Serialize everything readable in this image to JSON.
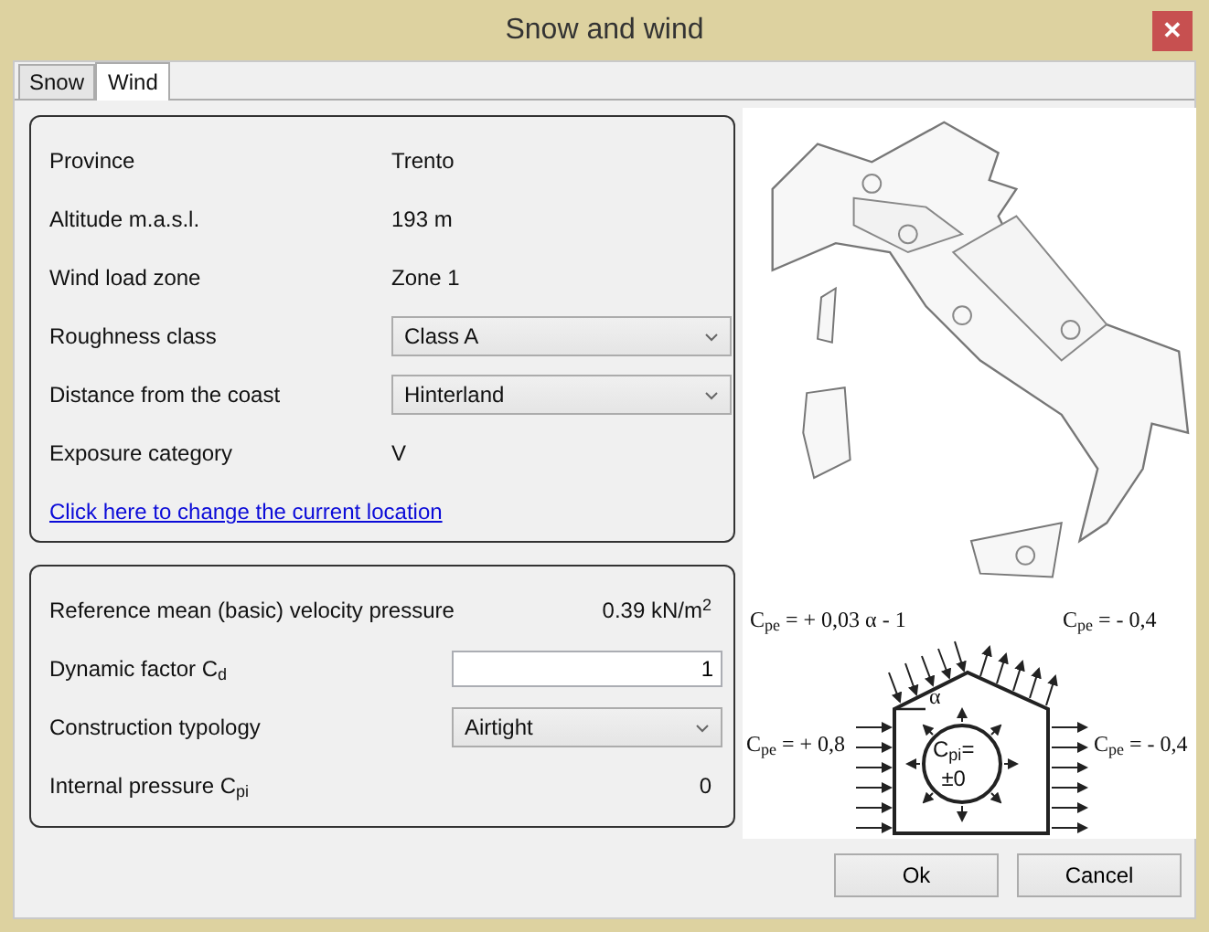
{
  "window": {
    "title": "Snow and wind",
    "close": "✕"
  },
  "tabs": [
    {
      "label": "Snow",
      "selected": false
    },
    {
      "label": "Wind",
      "selected": true
    }
  ],
  "location_panel": {
    "rows": [
      {
        "kind": "value",
        "label": "Province",
        "value": "Trento"
      },
      {
        "kind": "value",
        "label": "Altitude m.a.s.l.",
        "value": "193 m"
      },
      {
        "kind": "value",
        "label": "Wind load zone",
        "value": "Zone 1"
      },
      {
        "kind": "select",
        "label": "Roughness class",
        "value": "Class A"
      },
      {
        "kind": "select",
        "label": "Distance from the coast",
        "value": "Hinterland"
      },
      {
        "kind": "value",
        "label": "Exposure category",
        "value": "V"
      }
    ],
    "link": "Click here to change the current location"
  },
  "pressure_panel": {
    "rows": [
      {
        "kind": "value",
        "label": "Reference mean (basic) velocity pressure",
        "value": "0.39 kN/m$^{2}$"
      },
      {
        "kind": "input",
        "label": "Dynamic factor C$_{d}$",
        "value": "1"
      },
      {
        "kind": "select",
        "label": "Construction typology",
        "value": "Airtight"
      },
      {
        "kind": "value",
        "label": "Internal pressure C$_{pi}$",
        "value": "0"
      }
    ]
  },
  "diagram": {
    "roof_windward": "C$_{pe}$ = + 0,03 α - 1",
    "roof_leeward": "C$_{pe}$ = - 0,4",
    "wall_windward": "C$_{pe}$ = + 0,8",
    "wall_leeward": "C$_{pe}$ = - 0,4",
    "angle": "α",
    "internal": [
      "C$_{pi}$=",
      "±0"
    ]
  },
  "buttons": [
    "Ok",
    "Cancel"
  ]
}
